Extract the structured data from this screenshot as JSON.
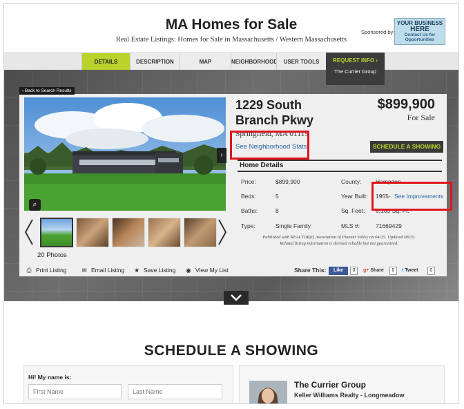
{
  "header": {
    "title": "MA Homes for Sale",
    "subtitle": "Real Estate Listings: Homes for Sale in Massachusetts / Western Massachusetts",
    "sponsor_label": "Sponsored by:",
    "ad": {
      "line1": "YOUR BUSINESS",
      "line2": "HERE",
      "line3": "Contact Us for Opportunities"
    }
  },
  "nav": {
    "tabs": [
      "DETAILS",
      "DESCRIPTION",
      "MAP",
      "NEIGHBORHOOD",
      "USER TOOLS"
    ],
    "request": {
      "label": "REQUEST INFO",
      "sub": "The Currier Group"
    }
  },
  "listing": {
    "back_link": "‹ Back to Search Results",
    "title": "1229 South Branch Pkwy",
    "price": "$899,900",
    "status": "For Sale",
    "city": "Springfield, MA 01119",
    "neighborhood_link": "See Neighborhood Stats",
    "schedule_button": "SCHEDULE A SHOWING",
    "details_heading": "Home Details",
    "details_left": [
      {
        "label": "Price:",
        "value": "$899,900"
      },
      {
        "label": "Beds:",
        "value": "5"
      },
      {
        "label": "Baths:",
        "value": "8"
      },
      {
        "label": "Type:",
        "value": "Single Family"
      }
    ],
    "details_right": [
      {
        "label": "County:",
        "value": "Hampden"
      },
      {
        "label": "Year Built:",
        "value": "1955-",
        "link": "See Improvements"
      },
      {
        "label": "Sq. Feet:",
        "value": "6,105 Sq. Ft."
      },
      {
        "label": "MLS #:",
        "value": "71669429"
      }
    ],
    "publish_note_1": "Published with REALTOR(r) Association of Pioneer Valley on 04/25. Updated 08/25.",
    "publish_note_2": "Related listing information is deemed reliable but not guaranteed.",
    "photos_count": "20 Photos"
  },
  "actions": {
    "print": "Print Listing",
    "email": "Email Listing",
    "save": "Save Listing",
    "view": "View My List"
  },
  "share": {
    "label": "Share This:",
    "like": "Like",
    "like_count": "0",
    "gshare": "Share",
    "gshare_count": "0",
    "tweet": "Tweet",
    "tweet_count": "0"
  },
  "schedule": {
    "title": "SCHEDULE A SHOWING",
    "form_label": "Hi! My name is:",
    "first_placeholder": "First Name",
    "last_placeholder": "Last Name",
    "agent_name": "The Currier Group",
    "agent_company": "Keller Williams Realty - Longmeadow"
  },
  "colors": {
    "accent": "#b9d32c",
    "link": "#2563a8",
    "highlight": "#e0141c"
  }
}
